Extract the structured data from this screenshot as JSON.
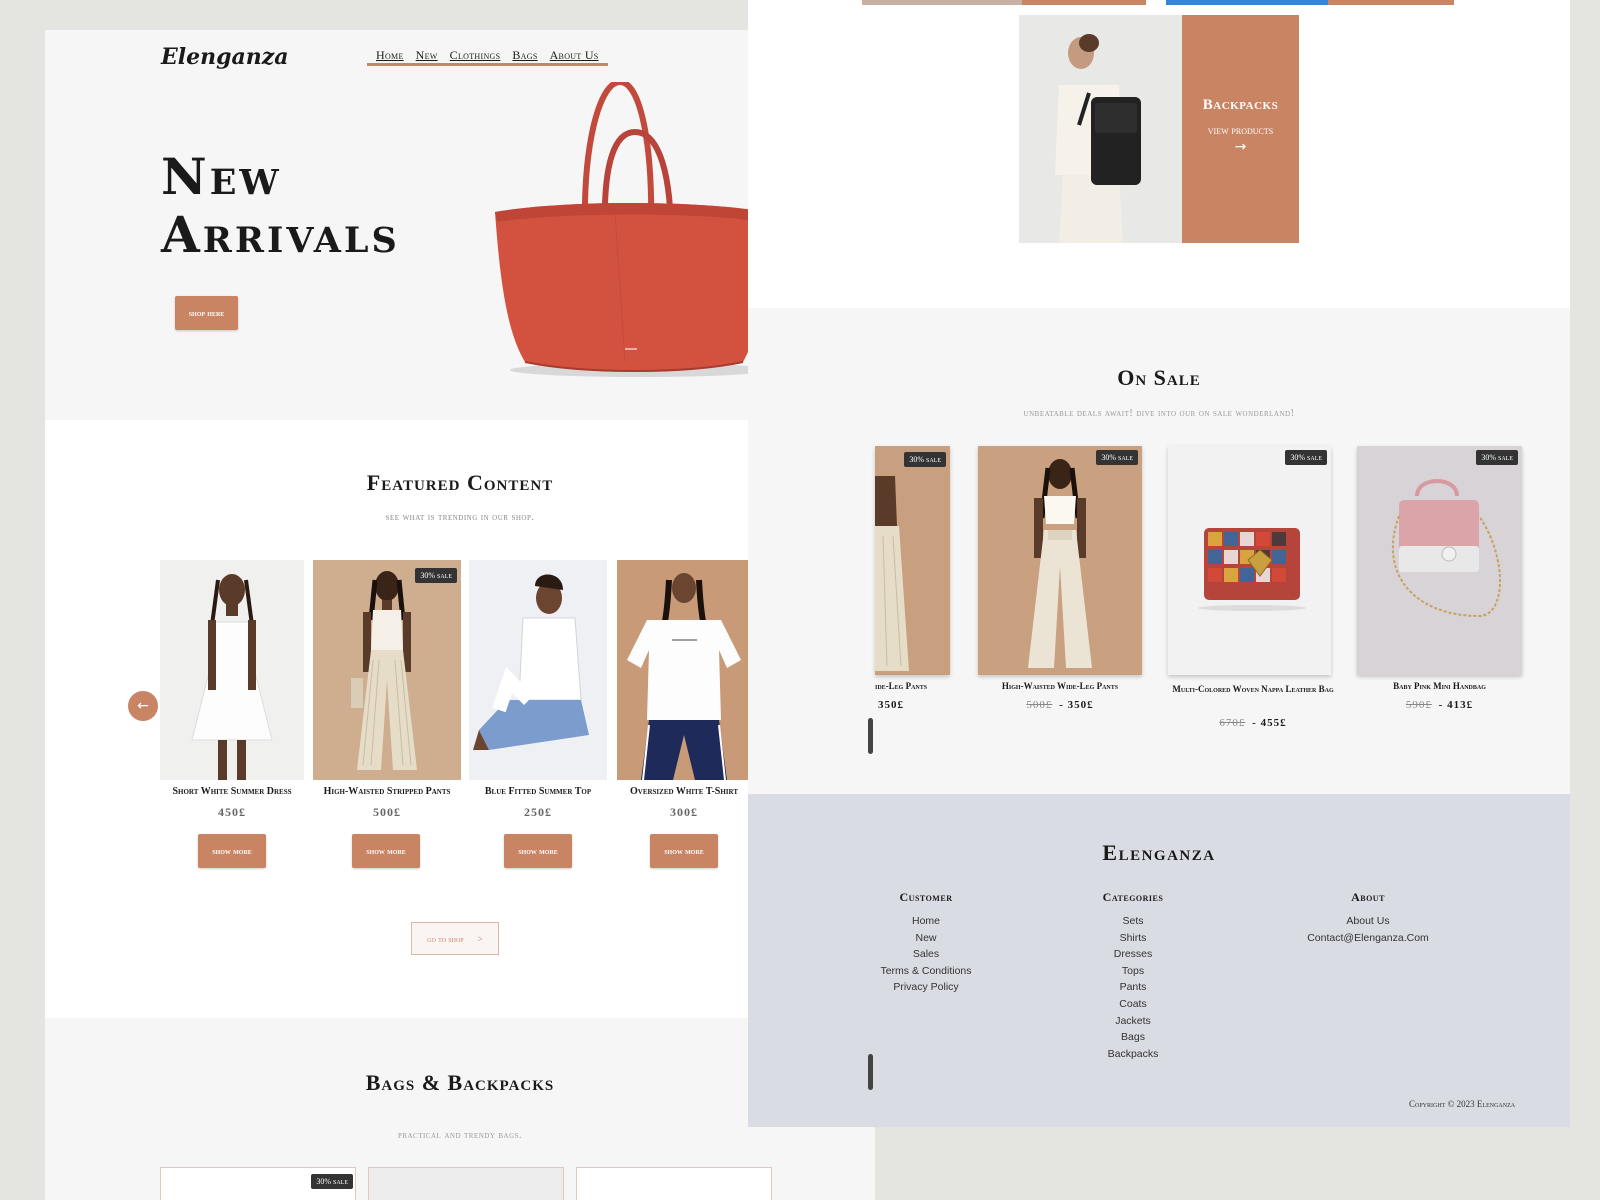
{
  "brand": {
    "logo": "Elenganza",
    "accent_color": "#c98463",
    "footer_name": "Elenganza"
  },
  "nav": {
    "items": [
      "Home",
      "New",
      "Clothings",
      "Bags",
      "About Us"
    ],
    "cart_icon": "shopping-bag-icon"
  },
  "hero": {
    "title": "New\nArrivals",
    "button": "shop here"
  },
  "featured": {
    "title": "Featured Content",
    "subtitle": "see what is trending in our shop.",
    "products": [
      {
        "name": "Short White Summer Dress",
        "price": "450£",
        "button": "show more"
      },
      {
        "name": "High-Waisted Stripped Pants",
        "price": "500£",
        "button": "show more",
        "badge": "30% sale"
      },
      {
        "name": "Blue Fitted Summer Top",
        "price": "250£",
        "button": "show more"
      },
      {
        "name": "Oversized White T-Shirt",
        "price": "300£",
        "button": "show more"
      }
    ],
    "prev_icon": "arrow-left-icon",
    "next_icon": "arrow-right-icon",
    "go_to_shop": "go to shop",
    "go_to_shop_arrow": ">"
  },
  "bags": {
    "title": "Bags & Backpacks",
    "subtitle": "practical and trendy bags.",
    "first_badge": "30% sale"
  },
  "backpacks_panel": {
    "title": "Backpacks",
    "link": "view products",
    "arrow": "→"
  },
  "on_sale": {
    "title": "On Sale",
    "subtitle": "unbeatable deals await! dive into our on sale wonderland!",
    "badge": "30% sale",
    "products": [
      {
        "name": "ide-Leg Pants",
        "old_price": "",
        "price": "350£"
      },
      {
        "name": "High-Waisted Wide-Leg Pants",
        "old_price": "500£",
        "price": "350£"
      },
      {
        "name": "Multi-Colored Woven Nappa Leather Bag",
        "old_price": "670£",
        "price": "455£"
      },
      {
        "name": "Baby Pink Mini Handbag",
        "old_price": "590£",
        "price": "413£"
      }
    ]
  },
  "footer": {
    "customer": {
      "title": "Customer",
      "items": [
        "Home",
        "New",
        "Sales",
        "Terms & Conditions",
        "Privacy Policy"
      ]
    },
    "categories": {
      "title": "Categories",
      "items": [
        "Sets",
        "Shirts",
        "Dresses",
        "Tops",
        "Pants",
        "Coats",
        "Jackets",
        "Bags",
        "Backpacks"
      ]
    },
    "about": {
      "title": "About",
      "items": [
        "About Us",
        "Contact@Elenganza.Com"
      ]
    },
    "copyright": "Copyright © 2023 Elenganza"
  }
}
